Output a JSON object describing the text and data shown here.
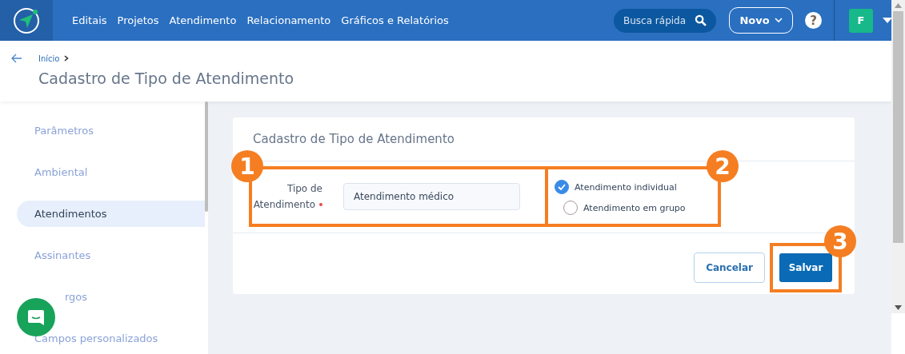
{
  "nav": {
    "links": [
      "Editais",
      "Projetos",
      "Atendimento",
      "Relacionamento",
      "Gráficos e Relatórios"
    ],
    "search": {
      "placeholder": "Busca rápida"
    },
    "new_button": "Novo",
    "help": "?",
    "avatar": "F"
  },
  "header": {
    "breadcrumb": "Início",
    "title": "Cadastro de Tipo de Atendimento"
  },
  "sidebar": {
    "items": [
      {
        "label": "Parâmetros",
        "selected": false
      },
      {
        "label": "Ambiental",
        "selected": false
      },
      {
        "label": "Atendimentos",
        "selected": true
      },
      {
        "label": "Assinantes",
        "selected": false
      },
      {
        "label": "rgos",
        "selected": false
      },
      {
        "label": "Campos personalizados",
        "selected": false
      }
    ]
  },
  "card": {
    "title": "Cadastro de Tipo de Atendimento",
    "field": {
      "label": "Tipo de Atendimento",
      "required": true,
      "value": "Atendimento médico"
    },
    "options": [
      {
        "label": "Atendimento individual",
        "selected": true
      },
      {
        "label": "Atendimento em grupo",
        "selected": false
      }
    ],
    "buttons": {
      "cancel": "Cancelar",
      "save": "Salvar"
    }
  },
  "annotations": [
    "1",
    "2",
    "3"
  ]
}
